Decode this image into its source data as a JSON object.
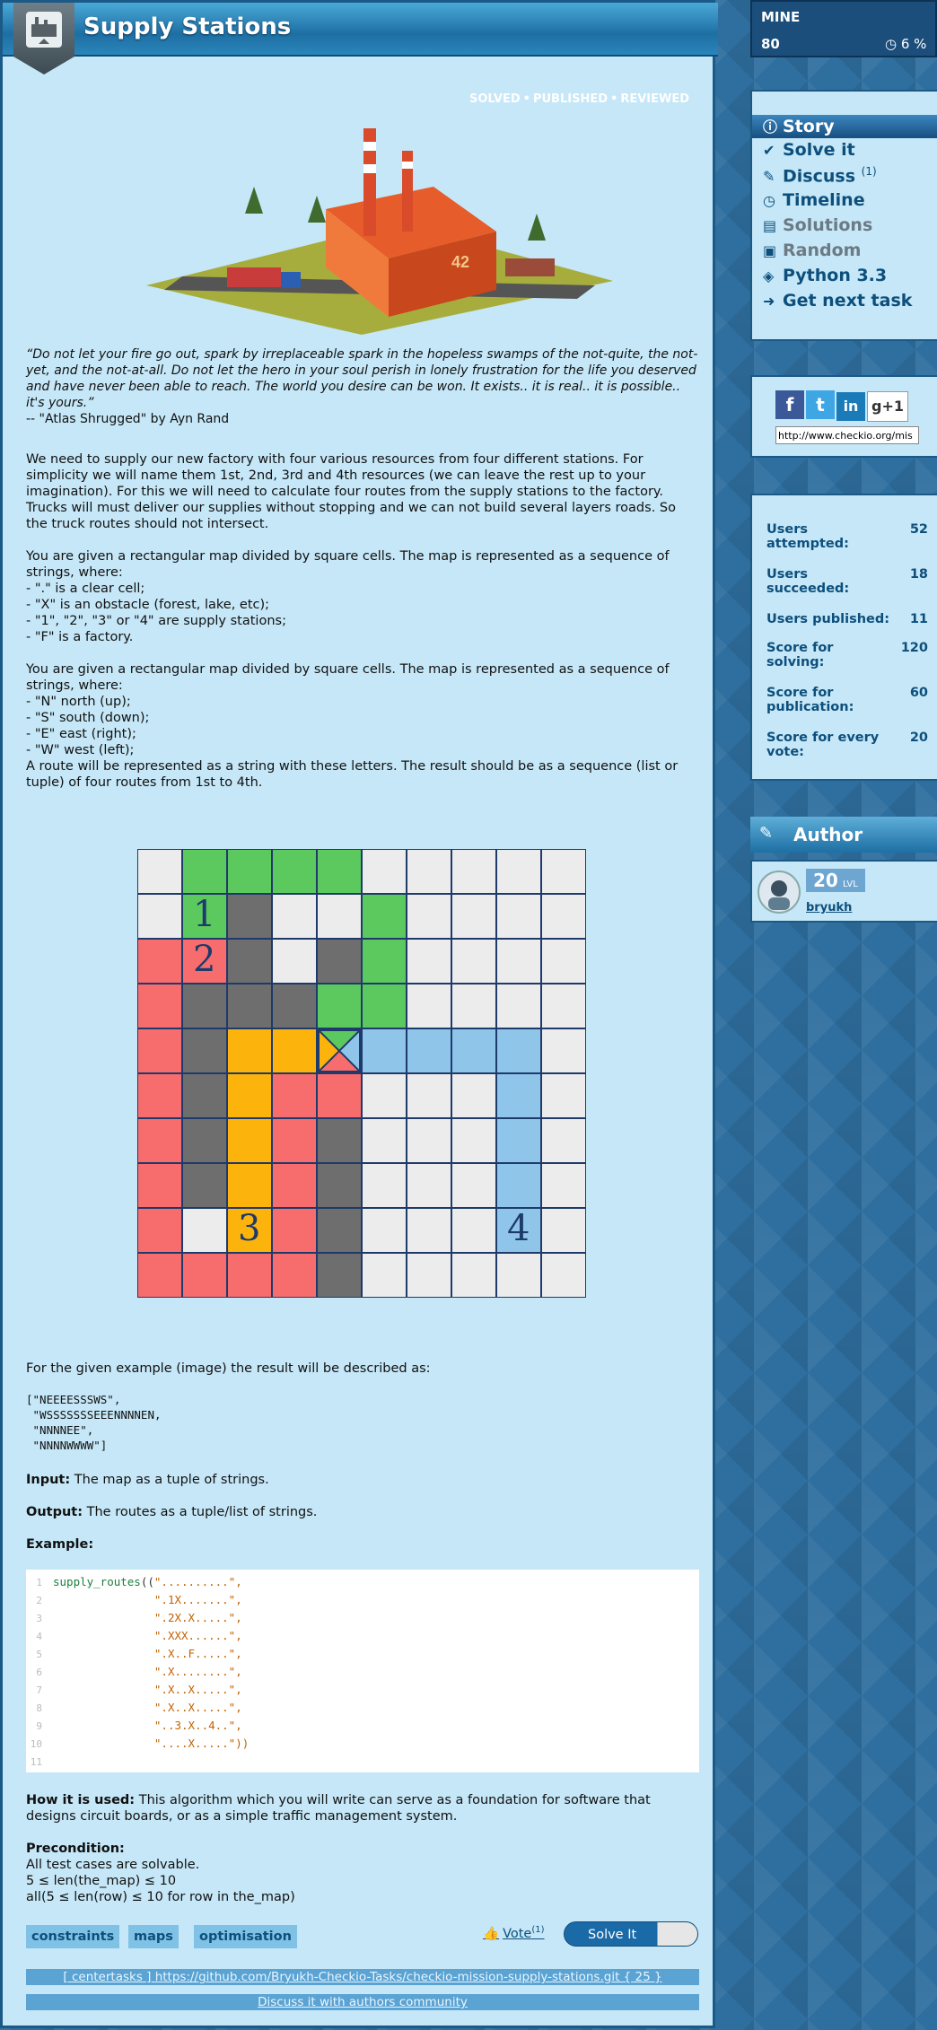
{
  "mission": {
    "title": "Supply Stations",
    "status": [
      "SOLVED",
      "PUBLISHED",
      "REVIEWED"
    ]
  },
  "quote": {
    "text": "“Do not let your fire go out, spark by irreplaceable spark in the hopeless swamps of the not-quite, the not-yet, and the not-at-all. Do not let the hero in your soul perish in lonely frustration for the life you deserved and have never been able to reach. The world you desire can be won. It exists.. it is real.. it is possible.. it's yours.”",
    "attribution": "-- \"Atlas Shrugged\" by Ayn Rand"
  },
  "story": {
    "p1": "We need to supply our new factory with four various resources from four different stations. For simplicity we will name them 1st, 2nd, 3rd and 4th resources (we can leave the rest up to your imagination). For this we will need to calculate four routes from the supply stations to the factory. Trucks will must deliver our supplies without stopping and we can not build several layers roads. So the truck routes should not intersect.",
    "p2_lines": [
      "You are given a rectangular map divided by square cells. The map is represented as a sequence of",
      "strings, where:",
      "- \".\" is a clear cell;",
      "- \"X\" is an obstacle (forest, lake, etc);",
      "- \"1\", \"2\", \"3\" or \"4\" are supply stations;",
      "- \"F\" is a factory."
    ],
    "p3_lines": [
      "You are given a rectangular map divided by square cells. The map is represented as a sequence of",
      "strings, where:",
      "- \"N\" north (up);",
      "- \"S\" south (down);",
      "- \"E\" east (right);",
      "- \"W\" west (left);",
      "A route will be represented as a string with these letters. The result should be as a sequence (list or",
      "tuple) of four routes from 1st to 4th."
    ]
  },
  "grid": {
    "rows": [
      "wggggwwwww",
      "w1xwwgwwww",
      "r2xwxgwwww",
      "rxxxggwwww",
      "rxyyFbbbbw",
      "rxyrrwwwbw",
      "rxyrxwwwbw",
      "rxyrxwwwbw",
      "rwyrxwwwbw",
      "rrrrxwwwww"
    ],
    "colors": {
      "w": "#ececec",
      "g": "#5cc95e",
      "x": "#6e6e6e",
      "r": "#f76d6d",
      "y": "#fcb40c",
      "b": "#90c5ea"
    },
    "labels": {
      "1": "1",
      "2": "2",
      "3": "3",
      "4": "4"
    },
    "station_positions": {
      "1": [
        1,
        1
      ],
      "2": [
        2,
        1
      ],
      "3": [
        8,
        2
      ],
      "4": [
        8,
        8
      ]
    }
  },
  "result": {
    "intro": "For the given example (image) the result will be described as:",
    "lines": [
      "[\"NEEEESSSWS\",",
      " \"WSSSSSSSEEENNNNEN,",
      " \"NNNNEE\",",
      " \"NNNNWWWW\"]"
    ]
  },
  "io": {
    "input_label": "Input:",
    "input_text": " The map as a tuple of strings.",
    "output_label": "Output:",
    "output_text": " The routes as a tuple/list of strings.",
    "example_label": "Example:"
  },
  "code": {
    "fn": "supply_routes",
    "lines": [
      "\"..........\",",
      "\".1X.......\",",
      "\".2X.X.....\",",
      "\".XXX......\",",
      "\".X..F.....\",",
      "\".X........\",",
      "\".X..X.....\",",
      "\".X..X.....\",",
      "\"..3.X..4..\",",
      "\"....X.....\"))",
      ""
    ]
  },
  "usage": {
    "label": "How it is used:",
    "text": " This algorithm which you will write can serve as a foundation for software that designs circuit boards, or as a simple traffic management system."
  },
  "precondition": {
    "label": "Precondition:",
    "lines": [
      "All test cases are solvable.",
      "5 ≤ len(the_map) ≤ 10",
      "all(5 ≤ len(row) ≤ 10 for row in the_map)"
    ]
  },
  "tags": [
    "constraints",
    "maps",
    "optimisation"
  ],
  "vote": {
    "label": "Vote",
    "count": "(1)"
  },
  "solve_button": "Solve It",
  "footer": {
    "repo": "[ centertasks ] https://github.com/Bryukh-Checkio-Tasks/checkio-mission-supply-stations.git { 25 }",
    "discuss": "Discuss it with authors community"
  },
  "sidebar": {
    "mine": {
      "title": "MINE",
      "score": "80",
      "percent": "6 %"
    },
    "nav": [
      {
        "label": "Story",
        "icon": "info-icon",
        "active": true
      },
      {
        "label": "Solve it",
        "icon": "check-icon"
      },
      {
        "label": "Discuss",
        "icon": "comment-icon",
        "count": "(1)"
      },
      {
        "label": "Timeline",
        "icon": "clock-icon"
      },
      {
        "label": "Solutions",
        "icon": "solutions-icon",
        "dim": true
      },
      {
        "label": "Random",
        "icon": "dice-icon",
        "dim": true
      },
      {
        "label": "Python 3.3",
        "icon": "python-icon"
      },
      {
        "label": "Get next task",
        "icon": "arrow-icon"
      }
    ],
    "share_url": "http://www.checkio.org/mis",
    "stats": [
      {
        "label": "Users attempted:",
        "value": "52"
      },
      {
        "label": "Users succeeded:",
        "value": "18"
      },
      {
        "label": "Users published:",
        "value": "11"
      },
      {
        "label": "Score for solving:",
        "value": "120"
      },
      {
        "label": "Score for publication:",
        "value": "60"
      },
      {
        "label": "Score for every vote:",
        "value": "20"
      }
    ],
    "author": {
      "title": "Author",
      "level": "20",
      "level_unit": "LVL",
      "name": "bryukh"
    }
  }
}
